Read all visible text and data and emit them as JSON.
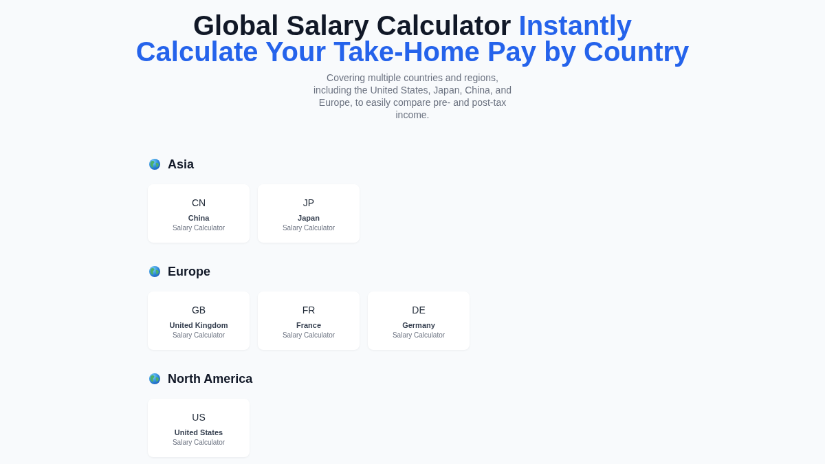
{
  "header": {
    "title": "Global Salary Calculator",
    "title_highlight": "Instantly Calculate Your Take-Home Pay by Country",
    "subtitle": "Covering multiple countries and regions, including the United States, Japan, China, and Europe, to easily compare pre- and post-tax income."
  },
  "regions": [
    {
      "name": "Asia",
      "countries": [
        {
          "code": "CN",
          "name": "China",
          "label": "Salary Calculator"
        },
        {
          "code": "JP",
          "name": "Japan",
          "label": "Salary Calculator"
        }
      ]
    },
    {
      "name": "Europe",
      "countries": [
        {
          "code": "GB",
          "name": "United Kingdom",
          "label": "Salary Calculator"
        },
        {
          "code": "FR",
          "name": "France",
          "label": "Salary Calculator"
        },
        {
          "code": "DE",
          "name": "Germany",
          "label": "Salary Calculator"
        }
      ]
    },
    {
      "name": "North America",
      "countries": [
        {
          "code": "US",
          "name": "United States",
          "label": "Salary Calculator"
        }
      ]
    }
  ]
}
